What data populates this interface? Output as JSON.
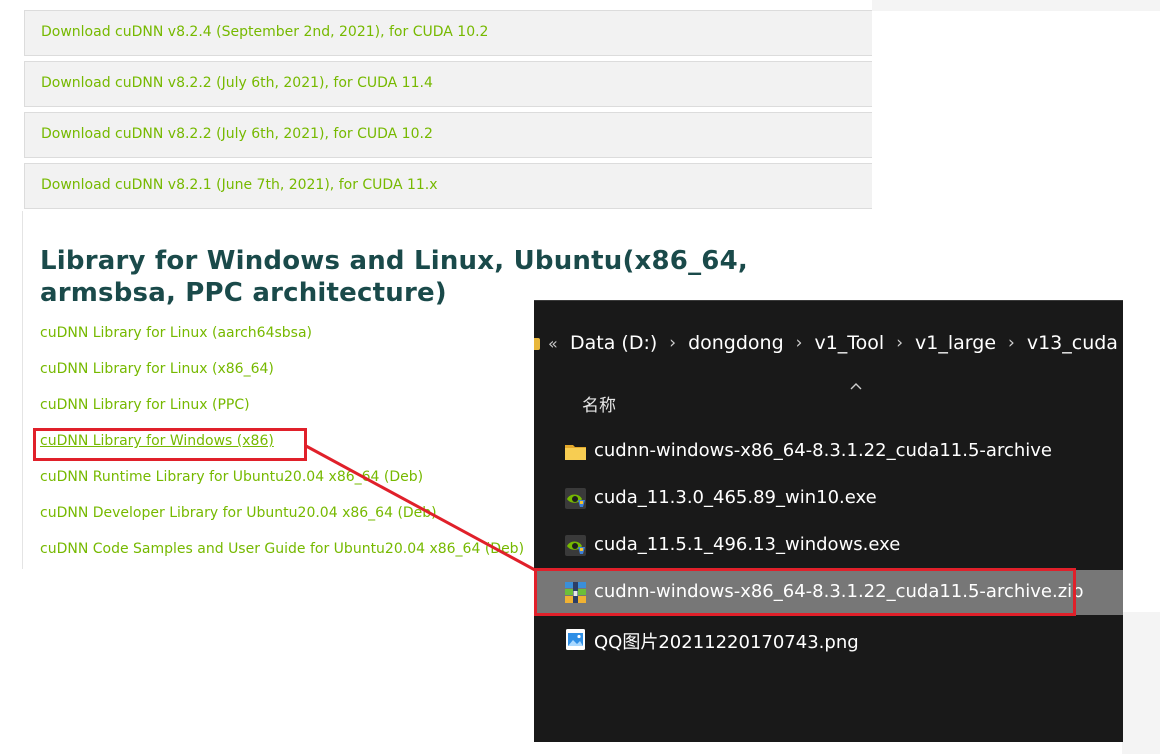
{
  "downloads": [
    "Download cuDNN v8.2.4 (September 2nd, 2021), for CUDA 10.2",
    "Download cuDNN v8.2.2 (July 6th, 2021), for CUDA 11.4",
    "Download cuDNN v8.2.2 (July 6th, 2021), for CUDA 10.2",
    "Download cuDNN v8.2.1 (June 7th, 2021), for CUDA 11.x"
  ],
  "section": {
    "title": "Library for Windows and Linux, Ubuntu(x86_64, armsbsa, PPC architecture)",
    "links": [
      "cuDNN Library for Linux (aarch64sbsa)",
      "cuDNN Library for Linux (x86_64)",
      "cuDNN Library for Linux (PPC)",
      "cuDNN Library for Windows (x86)",
      "cuDNN Runtime Library for Ubuntu20.04 x86_64 (Deb)",
      "cuDNN Developer Library for Ubuntu20.04 x86_64 (Deb)",
      "cuDNN Code Samples and User Guide for Ubuntu20.04 x86_64 (Deb)"
    ]
  },
  "explorer": {
    "breadcrumb": [
      "Data (D:)",
      "dongdong",
      "v1_Tool",
      "v1_large",
      "v13_cuda"
    ],
    "column_header": "名称",
    "files": [
      {
        "name": "cudnn-windows-x86_64-8.3.1.22_cuda11.5-archive",
        "icon": "folder-icon"
      },
      {
        "name": "cuda_11.3.0_465.89_win10.exe",
        "icon": "nvidia-installer-icon"
      },
      {
        "name": "cuda_11.5.1_496.13_windows.exe",
        "icon": "nvidia-installer-icon"
      },
      {
        "name": "cudnn-windows-x86_64-8.3.1.22_cuda11.5-archive.zip",
        "icon": "zip-archive-icon",
        "selected": true
      },
      {
        "name": "QQ图片20211220170743.png",
        "icon": "image-file-icon"
      }
    ]
  },
  "colors": {
    "link_green": "#76b900",
    "title_teal": "#1a4a4a",
    "highlight_red": "#e0202a",
    "explorer_bg": "#191919",
    "selected_row": "#777777"
  }
}
